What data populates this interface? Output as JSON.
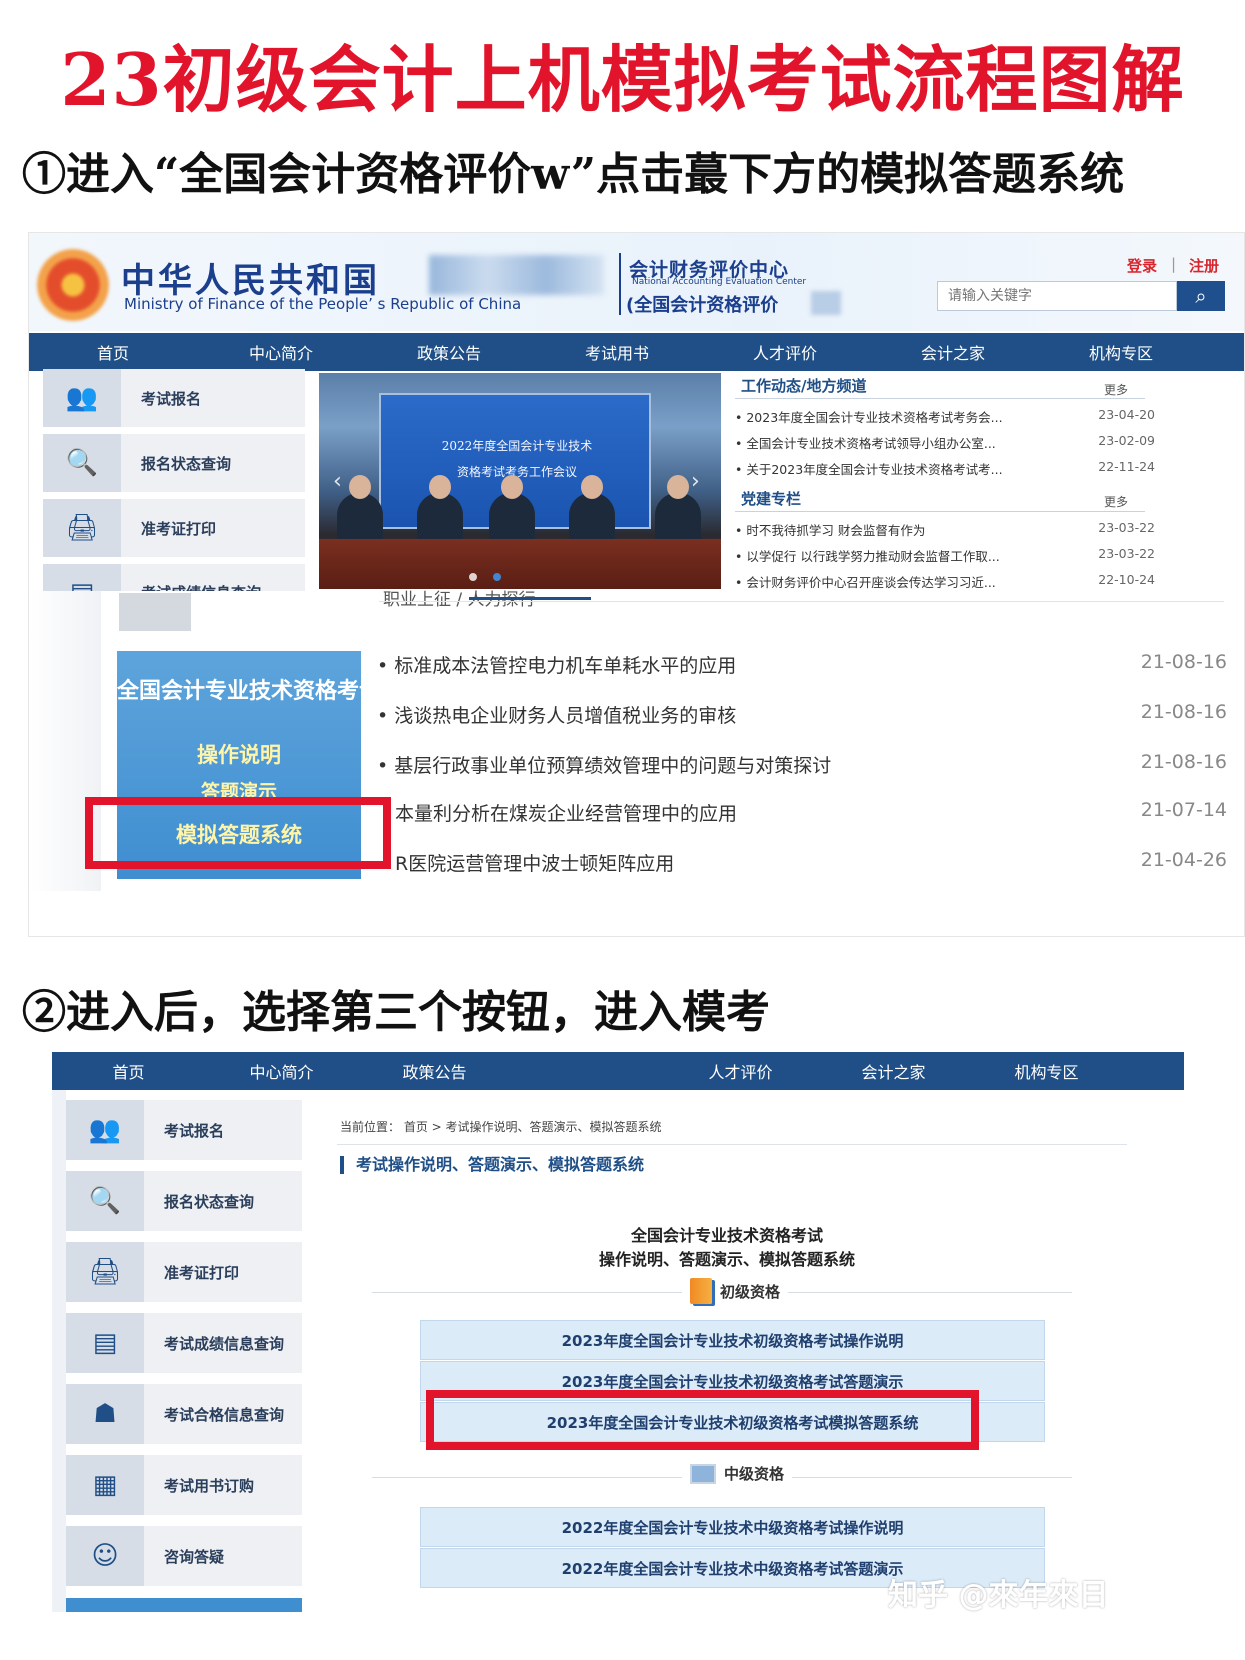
{
  "title": "23初级会计上机模拟考试流程图解",
  "step1": "①进入“全国会计资格评价w”点击蕞下方的模拟答题系统",
  "step2": "②进入后，选择第三个按钮，进入模考",
  "shot1": {
    "ministry_cn": "中华人民共和国",
    "ministry_en": "Ministry of Finance of the People’ s Republic of China",
    "center_cn": "会计财务评价中心",
    "center_en": "National Accounting Evaluation Center",
    "center_sub": "(全国会计资格评价",
    "login": "登录",
    "register": "注册",
    "search_placeholder": "请输入关键字",
    "search_icon": "search-icon",
    "nav": [
      "首页",
      "中心简介",
      "政策公告",
      "考试用书",
      "人才评价",
      "会计之家",
      "机构专区"
    ],
    "side": [
      {
        "label": "考试报名",
        "icon": "users-icon"
      },
      {
        "label": "报名状态查询",
        "icon": "status-search-icon"
      },
      {
        "label": "准考证打印",
        "icon": "printer-icon"
      },
      {
        "label": "考试成绩信息查询",
        "icon": "score-icon"
      }
    ],
    "banner_line1": "2022年度全国会计专业技术",
    "banner_line2": "资格考试考务工作会议",
    "news1": {
      "head": "工作动态/地方频道",
      "more": "更多",
      "items": [
        {
          "title": "2023年度全国会计专业技术资格考试考务会...",
          "date": "23-04-20"
        },
        {
          "title": "全国会计专业技术资格考试领导小组办公室...",
          "date": "23-02-09"
        },
        {
          "title": "关于2023年度全国会计专业技术资格考试考...",
          "date": "22-11-24"
        }
      ]
    },
    "news2": {
      "head": "党建专栏",
      "more": "更多",
      "items": [
        {
          "title": "时不我待抓学习 财会监督有作为",
          "date": "23-03-22"
        },
        {
          "title": "以学促行 以行践学努力推动财会监督工作取...",
          "date": "23-03-22"
        },
        {
          "title": "会计财务评价中心召开座谈会传达学习习近...",
          "date": "22-10-24"
        }
      ]
    },
    "partial_tabs": "职业上征 /   人力探行",
    "exam_panel": {
      "title": "全国会计专业技术资格考试",
      "op": "操作说明",
      "demo": "答题演示",
      "sim": "模拟答题系统"
    },
    "articles": [
      {
        "title": "• 标准成本法管控电力机车单耗水平的应用",
        "date": "21-08-16"
      },
      {
        "title": "• 浅谈热电企业财务人员增值税业务的审核",
        "date": "21-08-16"
      },
      {
        "title": "• 基层行政事业单位预算绩效管理中的问题与对策探讨",
        "date": "21-08-16"
      },
      {
        "title": "本量利分析在煤炭企业经营管理中的应用",
        "date": "21-07-14"
      },
      {
        "title": "R医院运营管理中波士顿矩阵应用",
        "date": "21-04-26"
      }
    ]
  },
  "shot2": {
    "nav": [
      "首页",
      "中心简介",
      "政策公告",
      "",
      "人才评价",
      "会计之家",
      "机构专区"
    ],
    "side": [
      {
        "label": "考试报名",
        "icon": "users-icon"
      },
      {
        "label": "报名状态查询",
        "icon": "status-search-icon"
      },
      {
        "label": "准考证打印",
        "icon": "printer-icon"
      },
      {
        "label": "考试成绩信息查询",
        "icon": "score-icon"
      },
      {
        "label": "考试合格信息查询",
        "icon": "certificate-icon"
      },
      {
        "label": "考试用书订购",
        "icon": "book-icon"
      },
      {
        "label": "咨询答疑",
        "icon": "support-icon"
      }
    ],
    "breadcrumb": "当前位置： 首页 > 考试操作说明、答题演示、模拟答题系统",
    "section_title": "考试操作说明、答题演示、模拟答题系统",
    "sys_title1": "全国会计专业技术资格考试",
    "sys_title2": "操作说明、答题演示、模拟答题系统",
    "group1": "初级资格",
    "group1_buttons": [
      "2023年度全国会计专业技术初级资格考试操作说明",
      "2023年度全国会计专业技术初级资格考试答题演示",
      "2023年度全国会计专业技术初级资格考试模拟答题系统"
    ],
    "group2": "中级资格",
    "group2_buttons": [
      "2022年度全国会计专业技术中级资格考试操作说明",
      "2022年度全国会计专业技术中级资格考试答题演示"
    ]
  },
  "watermark": "知乎 @來年來日",
  "colors": {
    "accent_red": "#e2142b",
    "nav_blue": "#1f4f86",
    "button_blue": "#dcebf8"
  }
}
